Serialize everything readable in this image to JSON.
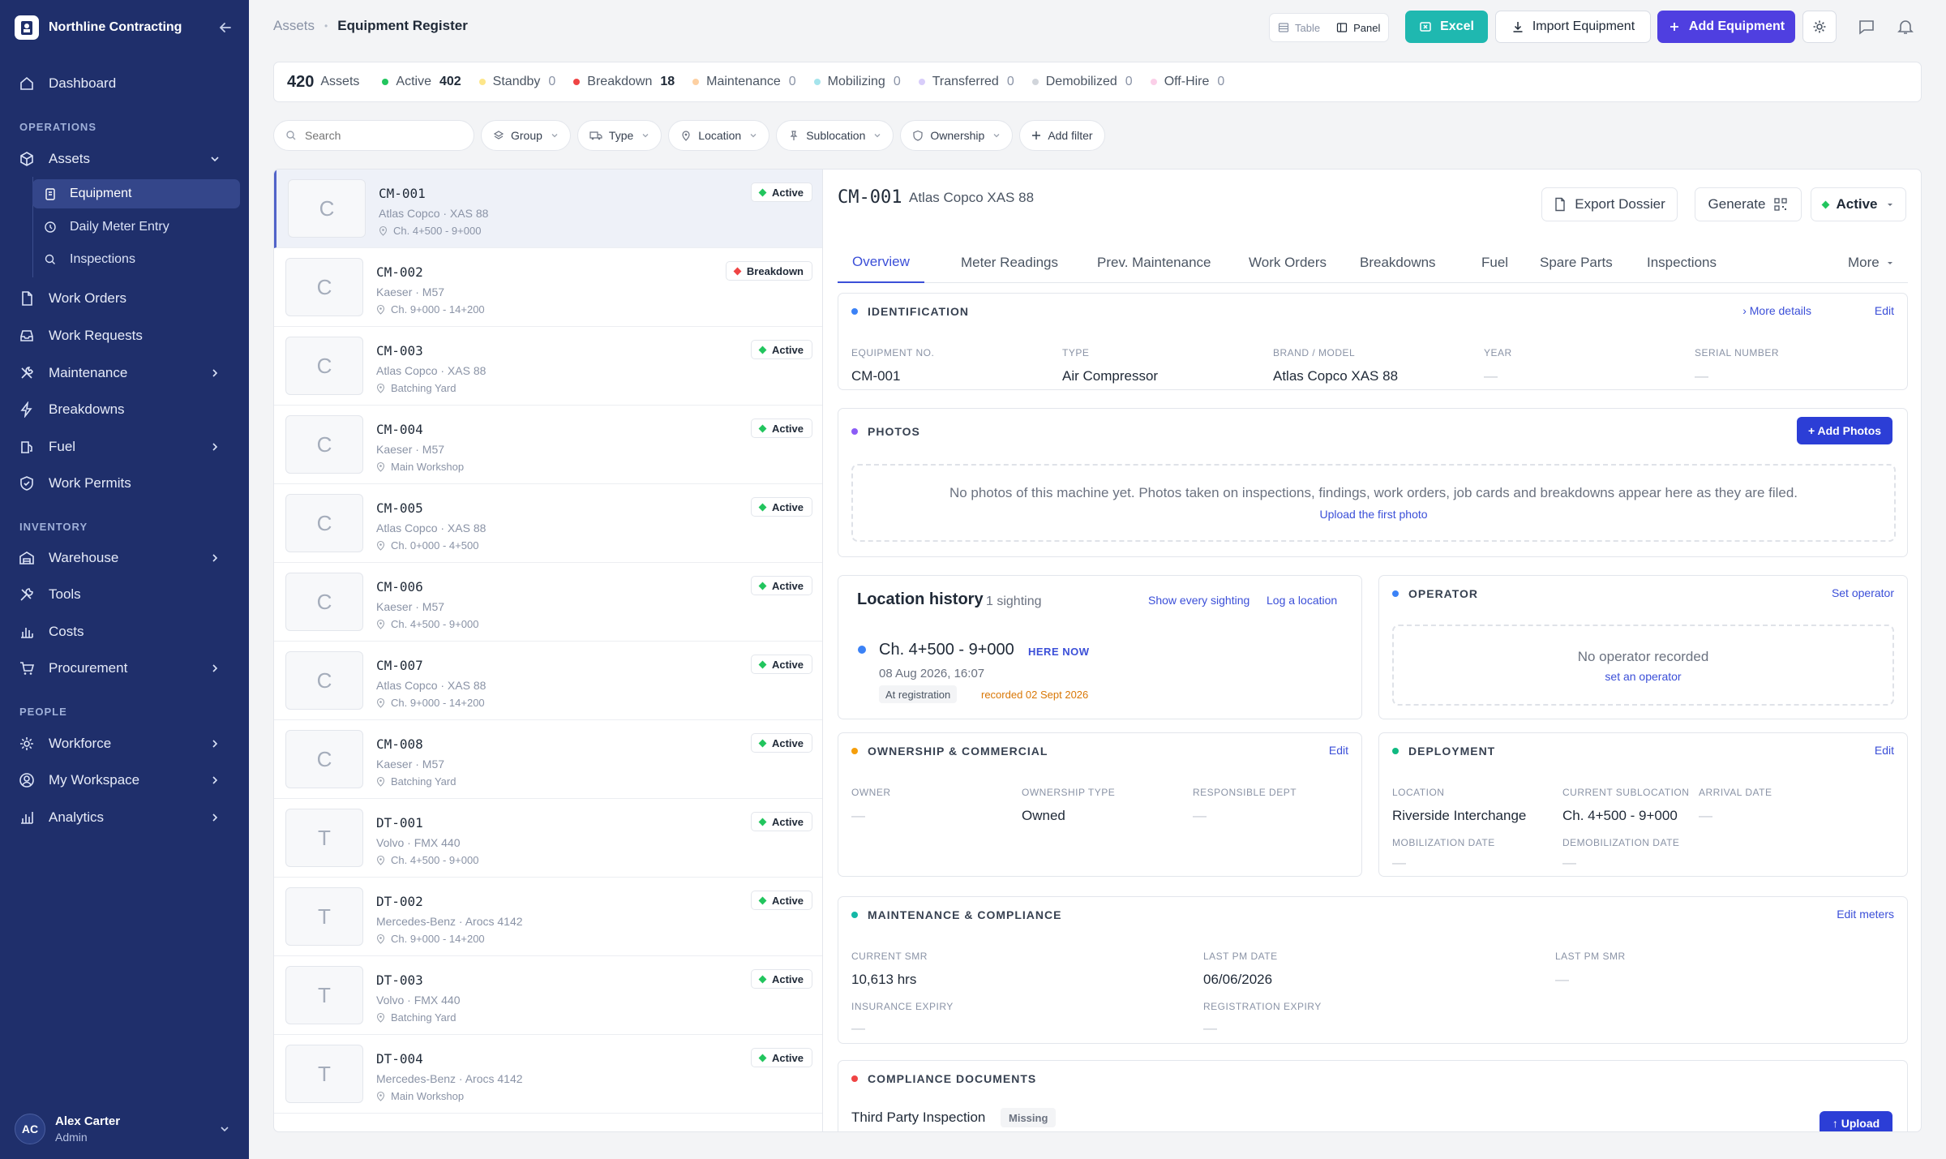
{
  "app": {
    "company": "Northline Contracting"
  },
  "sidebar": {
    "dashboard": "Dashboard",
    "sec_operations": "OPERATIONS",
    "assets": "Assets",
    "equipment": "Equipment",
    "daily_meter": "Daily Meter Entry",
    "inspections": "Inspections",
    "work_orders": "Work Orders",
    "work_requests": "Work Requests",
    "maintenance": "Maintenance",
    "breakdowns": "Breakdowns",
    "fuel": "Fuel",
    "work_permits": "Work Permits",
    "sec_inventory": "INVENTORY",
    "warehouse": "Warehouse",
    "tools": "Tools",
    "costs": "Costs",
    "procurement": "Procurement",
    "sec_people": "PEOPLE",
    "workforce": "Workforce",
    "my_workspace": "My Workspace",
    "analytics": "Analytics",
    "user": {
      "initials": "AC",
      "name": "Alex Carter",
      "role": "Admin"
    }
  },
  "header": {
    "crumb_root": "Assets",
    "crumb_sep": "•",
    "crumb_current": "Equipment Register",
    "view_table": "Table",
    "view_panel": "Panel",
    "excel": "Excel",
    "import": "Import Equipment",
    "add": "Add Equipment"
  },
  "status": {
    "total": "420",
    "total_label": "Assets",
    "items": [
      {
        "label": "Active",
        "count": "402",
        "color": "#22c55e",
        "bold": true
      },
      {
        "label": "Standby",
        "count": "0",
        "color": "#fde68a"
      },
      {
        "label": "Breakdown",
        "count": "18",
        "color": "#ef4444",
        "bold": true
      },
      {
        "label": "Maintenance",
        "count": "0",
        "color": "#fdd0a2"
      },
      {
        "label": "Mobilizing",
        "count": "0",
        "color": "#a5e4ec"
      },
      {
        "label": "Transferred",
        "count": "0",
        "color": "#d8cdfa"
      },
      {
        "label": "Demobilized",
        "count": "0",
        "color": "#d1d5db"
      },
      {
        "label": "Off-Hire",
        "count": "0",
        "color": "#fbcfe8"
      }
    ]
  },
  "filters": {
    "search_placeholder": "Search",
    "group": "Group",
    "type": "Type",
    "location": "Location",
    "sublocation": "Sublocation",
    "ownership": "Ownership",
    "add_filter": "Add filter"
  },
  "assets": [
    {
      "letter": "C",
      "code": "CM-001",
      "model": "Atlas Copco · XAS 88",
      "location": "Ch. 4+500 - 9+000",
      "status": "Active"
    },
    {
      "letter": "C",
      "code": "CM-002",
      "model": "Kaeser · M57",
      "location": "Ch. 9+000 - 14+200",
      "status": "Breakdown"
    },
    {
      "letter": "C",
      "code": "CM-003",
      "model": "Atlas Copco · XAS 88",
      "location": "Batching Yard",
      "status": "Active"
    },
    {
      "letter": "C",
      "code": "CM-004",
      "model": "Kaeser · M57",
      "location": "Main Workshop",
      "status": "Active"
    },
    {
      "letter": "C",
      "code": "CM-005",
      "model": "Atlas Copco · XAS 88",
      "location": "Ch. 0+000 - 4+500",
      "status": "Active"
    },
    {
      "letter": "C",
      "code": "CM-006",
      "model": "Kaeser · M57",
      "location": "Ch. 4+500 - 9+000",
      "status": "Active"
    },
    {
      "letter": "C",
      "code": "CM-007",
      "model": "Atlas Copco · XAS 88",
      "location": "Ch. 9+000 - 14+200",
      "status": "Active"
    },
    {
      "letter": "C",
      "code": "CM-008",
      "model": "Kaeser · M57",
      "location": "Batching Yard",
      "status": "Active"
    },
    {
      "letter": "T",
      "code": "DT-001",
      "model": "Volvo · FMX 440",
      "location": "Ch. 4+500 - 9+000",
      "status": "Active"
    },
    {
      "letter": "T",
      "code": "DT-002",
      "model": "Mercedes-Benz · Arocs 4142",
      "location": "Ch. 9+000 - 14+200",
      "status": "Active"
    },
    {
      "letter": "T",
      "code": "DT-003",
      "model": "Volvo · FMX 440",
      "location": "Batching Yard",
      "status": "Active"
    },
    {
      "letter": "T",
      "code": "DT-004",
      "model": "Mercedes-Benz · Arocs 4142",
      "location": "Main Workshop",
      "status": "Active"
    }
  ],
  "detail": {
    "code": "CM-001",
    "model": "Atlas Copco XAS 88",
    "export": "Export Dossier",
    "generate": "Generate",
    "status": "Active",
    "tabs": [
      "Overview",
      "Meter Readings",
      "Prev. Maintenance",
      "Work Orders",
      "Breakdowns",
      "Fuel",
      "Spare Parts",
      "Inspections",
      "More"
    ],
    "ident": {
      "title": "IDENTIFICATION",
      "more": "› More details",
      "edit": "Edit",
      "f1l": "EQUIPMENT NO.",
      "f1v": "CM-001",
      "f2l": "TYPE",
      "f2v": "Air Compressor",
      "f3l": "BRAND / MODEL",
      "f3v": "Atlas Copco XAS 88",
      "f4l": "YEAR",
      "f4v": "—",
      "f5l": "SERIAL NUMBER",
      "f5v": "—"
    },
    "photos": {
      "title": "PHOTOS",
      "add": "+ Add Photos",
      "empty": "No photos of this machine yet. Photos taken on inspections, findings, work orders, job cards and breakdowns appear here as they are filed.",
      "upload": "Upload the first photo"
    },
    "lochist": {
      "title": "Location history",
      "count": "1 sighting",
      "show": "Show every sighting",
      "log": "Log a location",
      "loc": "Ch. 4+500 - 9+000",
      "now": "HERE NOW",
      "date": "08 Aug 2026, 16:07",
      "tag": "At registration",
      "rec": "recorded 02 Sept 2026"
    },
    "operator": {
      "title": "OPERATOR",
      "set": "Set operator",
      "empty": "No operator recorded",
      "link": "set an operator"
    },
    "ownership": {
      "title": "OWNERSHIP & COMMERCIAL",
      "edit": "Edit",
      "f1l": "OWNER",
      "f1v": "—",
      "f2l": "OWNERSHIP TYPE",
      "f2v": "Owned",
      "f3l": "RESPONSIBLE DEPT",
      "f3v": "—"
    },
    "deploy": {
      "title": "DEPLOYMENT",
      "edit": "Edit",
      "f1l": "LOCATION",
      "f1v": "Riverside Interchange",
      "f2l": "CURRENT SUBLOCATION",
      "f2v": "Ch. 4+500 - 9+000",
      "f3l": "ARRIVAL DATE",
      "f3v": "—",
      "f4l": "MOBILIZATION DATE",
      "f4v": "—",
      "f5l": "DEMOBILIZATION DATE",
      "f5v": "—"
    },
    "maint": {
      "title": "MAINTENANCE & COMPLIANCE",
      "edit": "Edit meters",
      "f1l": "CURRENT SMR",
      "f1v": "10,613 hrs",
      "f2l": "LAST PM DATE",
      "f2v": "06/06/2026",
      "f3l": "LAST PM SMR",
      "f3v": "—",
      "f4l": "INSURANCE EXPIRY",
      "f4v": "—",
      "f5l": "REGISTRATION EXPIRY",
      "f5v": "—"
    },
    "docs": {
      "title": "COMPLIANCE DOCUMENTS",
      "doc1": "Third Party Inspection",
      "doc1status": "Missing",
      "upload": "↑ Upload"
    }
  }
}
